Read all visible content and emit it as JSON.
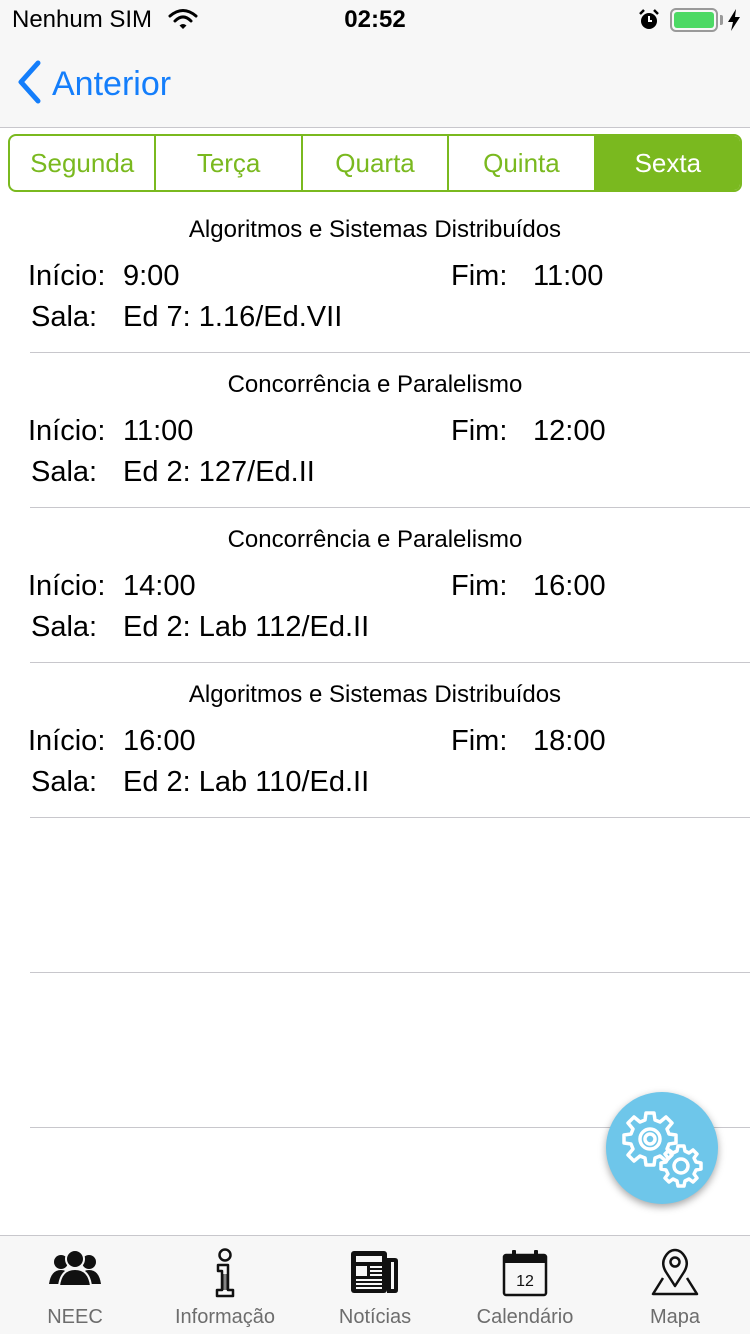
{
  "status_bar": {
    "carrier": "Nenhum SIM",
    "time": "02:52"
  },
  "nav": {
    "back_label": "Anterior"
  },
  "days": {
    "selected": "Sexta",
    "items": [
      "Segunda",
      "Terça",
      "Quarta",
      "Quinta",
      "Sexta"
    ]
  },
  "labels": {
    "start": "Início:",
    "end": "Fim:",
    "room": "Sala:"
  },
  "classes": [
    {
      "course": "Algoritmos e Sistemas Distribuídos",
      "start": "9:00",
      "end": "11:00",
      "room": "Ed 7: 1.16/Ed.VII"
    },
    {
      "course": "Concorrência e Paralelismo",
      "start": "11:00",
      "end": "12:00",
      "room": "Ed 2: 127/Ed.II"
    },
    {
      "course": "Concorrência e Paralelismo",
      "start": "14:00",
      "end": "16:00",
      "room": "Ed 2: Lab 112/Ed.II"
    },
    {
      "course": "Algoritmos e Sistemas Distribuídos",
      "start": "16:00",
      "end": "18:00",
      "room": "Ed 2: Lab 110/Ed.II"
    }
  ],
  "tab_bar": {
    "items": [
      {
        "label": "NEEC",
        "icon": "group-icon"
      },
      {
        "label": "Informação",
        "icon": "info-icon"
      },
      {
        "label": "Notícias",
        "icon": "newspaper-icon"
      },
      {
        "label": "Calendário",
        "icon": "calendar-icon",
        "calendar_day": "12"
      },
      {
        "label": "Mapa",
        "icon": "map-pin-icon"
      }
    ]
  },
  "colors": {
    "accent_green": "#7ab91f",
    "ios_blue": "#147efb",
    "fab_blue": "#6ec6ea",
    "battery_green": "#4cd964"
  }
}
